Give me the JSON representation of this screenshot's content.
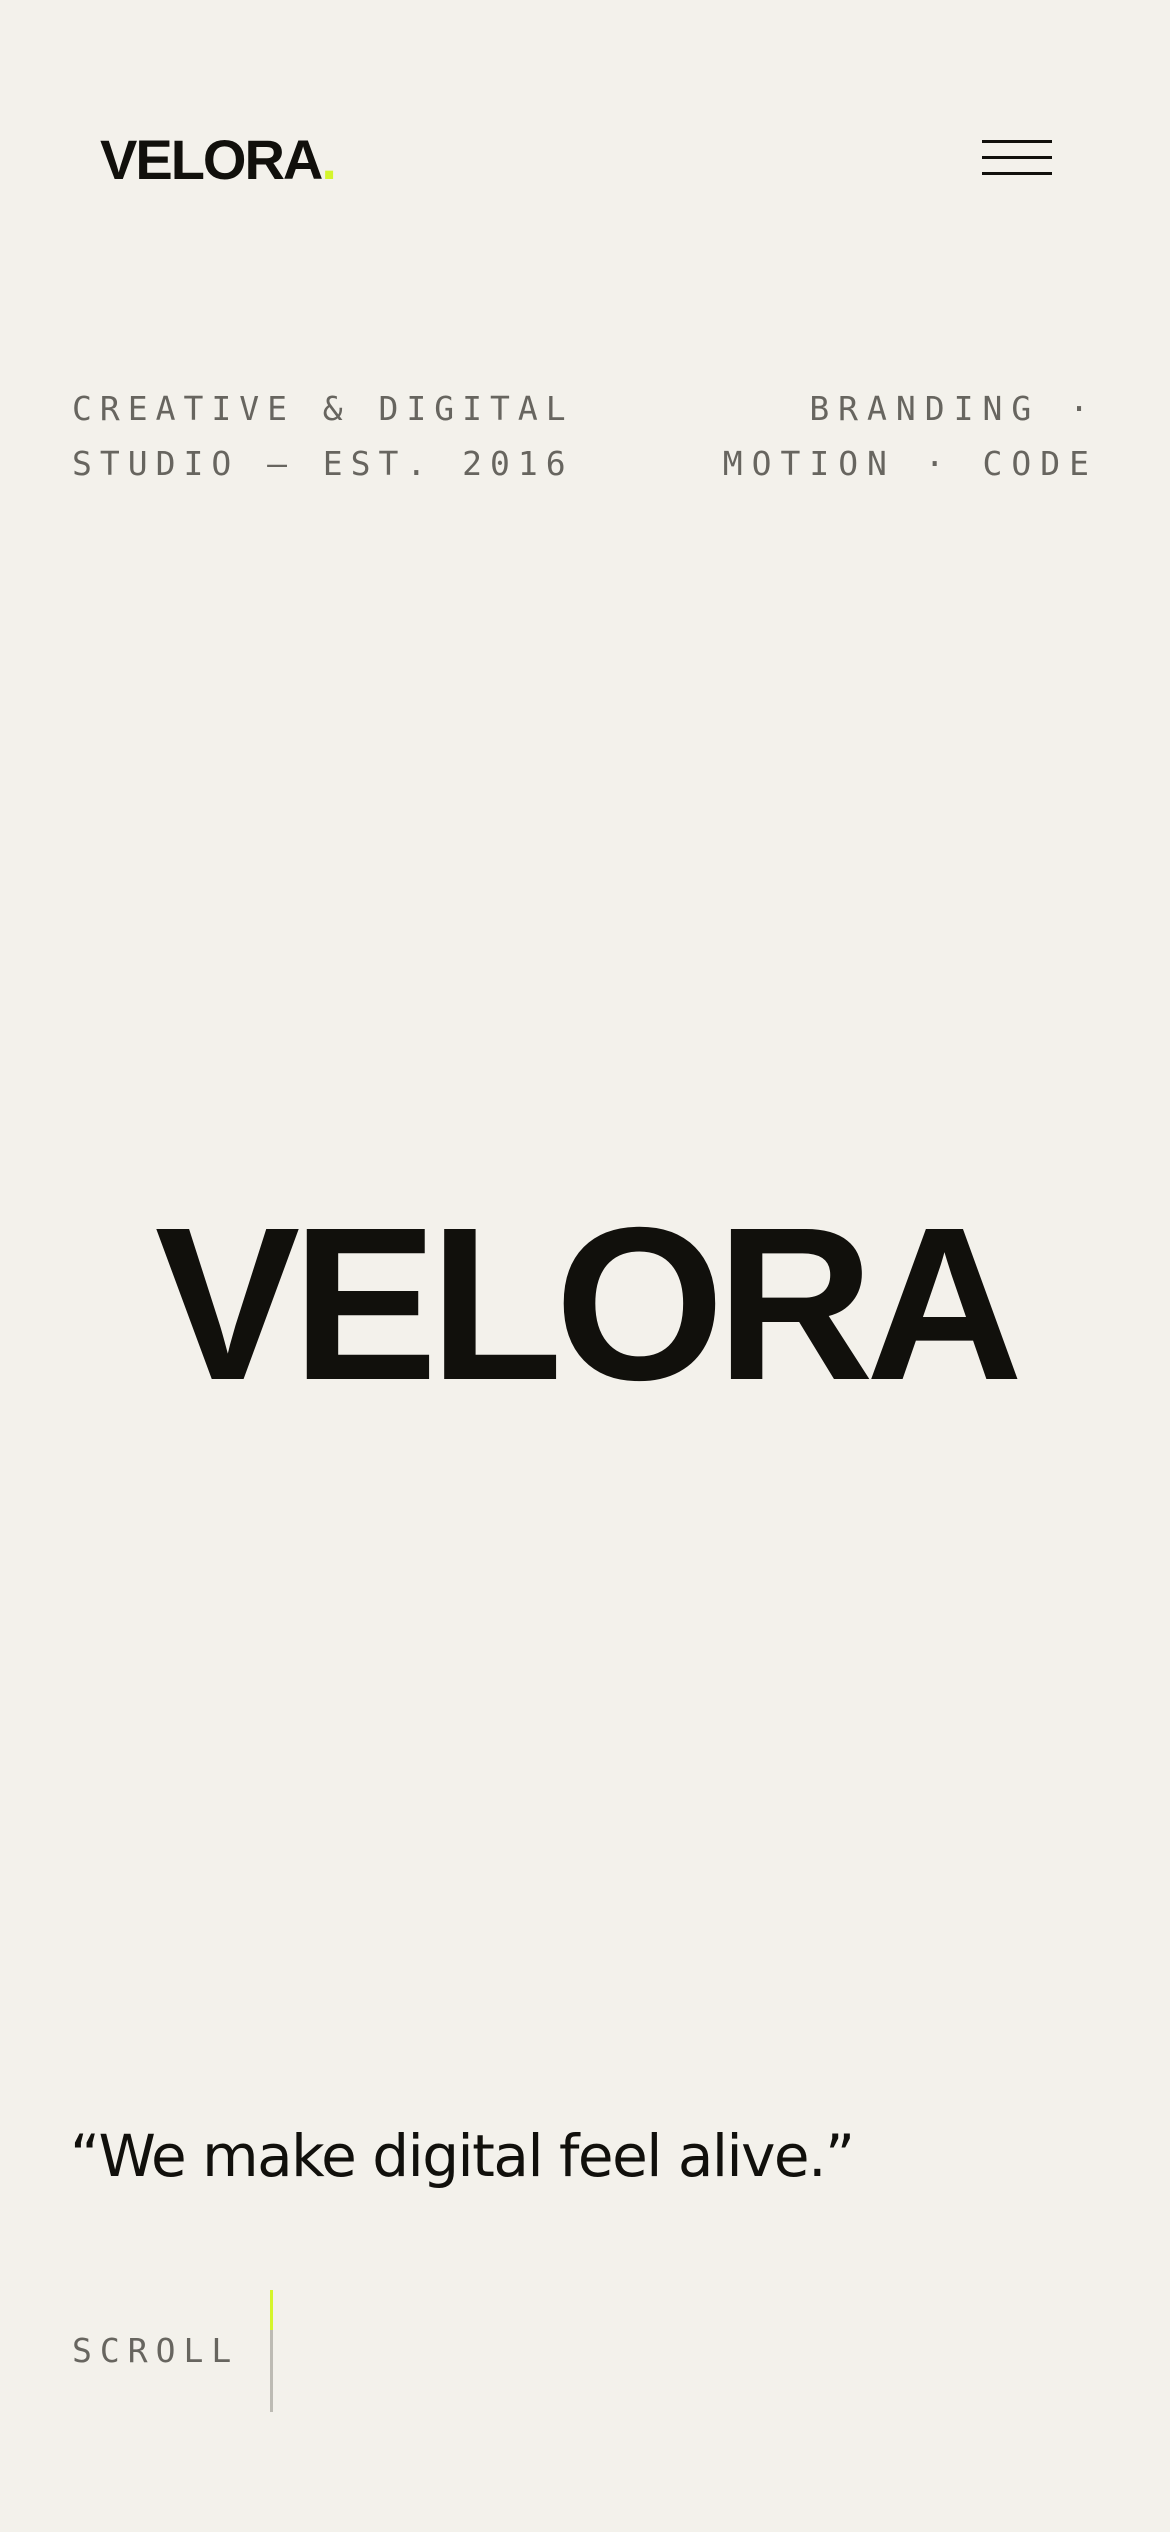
{
  "header": {
    "logo_text": "VELORA",
    "logo_dot": ".",
    "menu_icon": "hamburger-menu-icon"
  },
  "tagline": {
    "left_line1": "CREATIVE & DIGITAL",
    "left_line2": "STUDIO — EST. 2016",
    "right_line1": "BRANDING ·",
    "right_line2": "MOTION · CODE"
  },
  "hero": {
    "title": "VELORA"
  },
  "quote": {
    "text": "“We make digital feel alive.”"
  },
  "scroll": {
    "label": "SCROLL"
  },
  "colors": {
    "background": "#f3f1eb",
    "text": "#11100c",
    "muted": "#67655f",
    "accent": "#d4f52c"
  }
}
